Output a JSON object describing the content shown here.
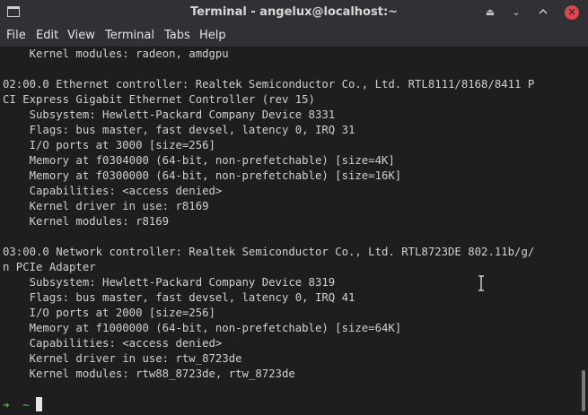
{
  "window": {
    "title": "Terminal - angelux@localhost:~",
    "icon": "terminal-icon",
    "controls": [
      "hide-icon",
      "restore-icon",
      "maximize-icon",
      "close-icon"
    ],
    "close_color": "#e0444e"
  },
  "menubar": {
    "items": [
      "File",
      "Edit",
      "View",
      "Terminal",
      "Tabs",
      "Help"
    ]
  },
  "terminal": {
    "lines": [
      "    Kernel modules: radeon, amdgpu",
      "",
      "02:00.0 Ethernet controller: Realtek Semiconductor Co., Ltd. RTL8111/8168/8411 P",
      "CI Express Gigabit Ethernet Controller (rev 15)",
      "    Subsystem: Hewlett-Packard Company Device 8331",
      "    Flags: bus master, fast devsel, latency 0, IRQ 31",
      "    I/O ports at 3000 [size=256]",
      "    Memory at f0304000 (64-bit, non-prefetchable) [size=4K]",
      "    Memory at f0300000 (64-bit, non-prefetchable) [size=16K]",
      "    Capabilities: <access denied>",
      "    Kernel driver in use: r8169",
      "    Kernel modules: r8169",
      "",
      "03:00.0 Network controller: Realtek Semiconductor Co., Ltd. RTL8723DE 802.11b/g/",
      "n PCIe Adapter",
      "    Subsystem: Hewlett-Packard Company Device 8319",
      "    Flags: bus master, fast devsel, latency 0, IRQ 41",
      "    I/O ports at 2000 [size=256]",
      "    Memory at f1000000 (64-bit, non-prefetchable) [size=64K]",
      "    Capabilities: <access denied>",
      "    Kernel driver in use: rtw_8723de",
      "    Kernel modules: rtw88_8723de, rtw_8723de"
    ],
    "prompt_arrow": "➜",
    "prompt_dir": "~",
    "prompt_color": "#4fc34f"
  }
}
